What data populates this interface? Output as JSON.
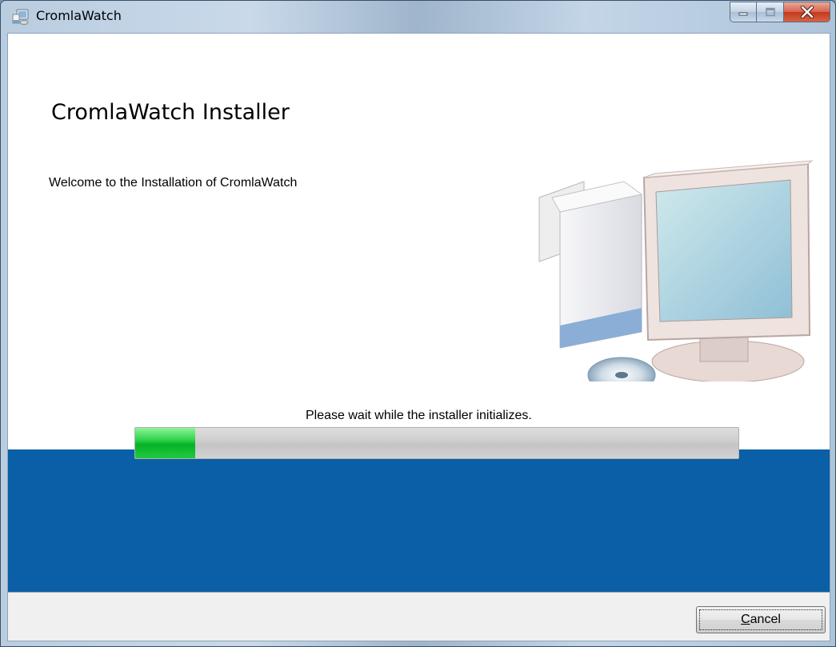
{
  "window": {
    "title": "CromlaWatch",
    "icon": "installer-app-icon",
    "controls": {
      "minimize_icon": "minimize-icon",
      "maximize_icon": "maximize-icon",
      "close_icon": "close-icon"
    }
  },
  "installer": {
    "heading": "CromlaWatch Installer",
    "welcome_text": "Welcome to the Installation of CromlaWatch",
    "illustration": "computer-with-box-and-cd-illustration",
    "status_text": "Please wait while the installer initializes.",
    "progress_percent": 10
  },
  "footer": {
    "cancel_mnemonic": "C",
    "cancel_rest": "ancel"
  },
  "colors": {
    "band_blue": "#0a5fa6",
    "progress_green": "#06b325",
    "close_red": "#c23a1f"
  }
}
